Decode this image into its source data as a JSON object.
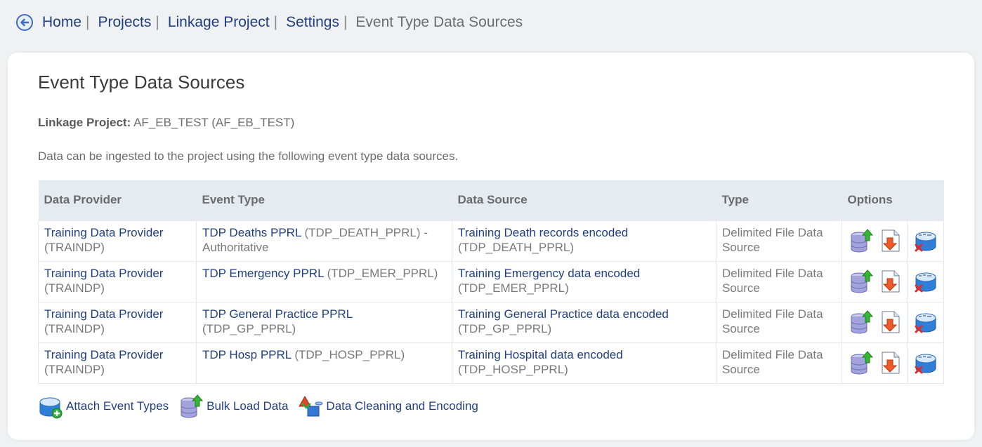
{
  "breadcrumb": {
    "items": [
      "Home",
      "Projects",
      "Linkage Project",
      "Settings"
    ],
    "separator": "|",
    "current": "Event Type Data Sources"
  },
  "page": {
    "title": "Event Type Data Sources",
    "project_label": "Linkage Project:",
    "project_value": "AF_EB_TEST (AF_EB_TEST)",
    "intro": "Data can be ingested to the project using the following event type data sources."
  },
  "table": {
    "headers": [
      "Data Provider",
      "Event Type",
      "Data Source",
      "Type",
      "Options"
    ],
    "rows": [
      {
        "provider_name": "Training Data Provider",
        "provider_code": "(TRAINDP)",
        "event_name": "TDP Deaths PPRL",
        "event_code": "(TDP_DEATH_PPRL) - Authoritative",
        "source_name": "Training Death records encoded",
        "source_code": "(TDP_DEATH_PPRL)",
        "type": "Delimited File Data Source"
      },
      {
        "provider_name": "Training Data Provider",
        "provider_code": "(TRAINDP)",
        "event_name": "TDP Emergency PPRL",
        "event_code": "(TDP_EMER_PPRL)",
        "source_name": "Training Emergency data encoded",
        "source_code": "(TDP_EMER_PPRL)",
        "type": "Delimited File Data Source"
      },
      {
        "provider_name": "Training Data Provider",
        "provider_code": "(TRAINDP)",
        "event_name": "TDP General Practice PPRL",
        "event_code": "(TDP_GP_PPRL)",
        "source_name": "Training General Practice data encoded",
        "source_code": "(TDP_GP_PPRL)",
        "type": "Delimited File Data Source"
      },
      {
        "provider_name": "Training Data Provider",
        "provider_code": "(TRAINDP)",
        "event_name": "TDP Hosp PPRL",
        "event_code": "(TDP_HOSP_PPRL)",
        "source_name": "Training Hospital data encoded",
        "source_code": "(TDP_HOSP_PPRL)",
        "type": "Delimited File Data Source"
      }
    ]
  },
  "actions": {
    "attach": "Attach Event Types",
    "bulk": "Bulk Load Data",
    "cleaning": "Data Cleaning and Encoding"
  },
  "icons": {
    "back": "back-arrow-icon",
    "load": "database-upload-icon",
    "download": "document-download-icon",
    "remove": "database-remove-icon"
  },
  "colors": {
    "link": "#1f3f80",
    "header_bg": "#e6ebf1",
    "page_bg": "#f0f1f2"
  }
}
